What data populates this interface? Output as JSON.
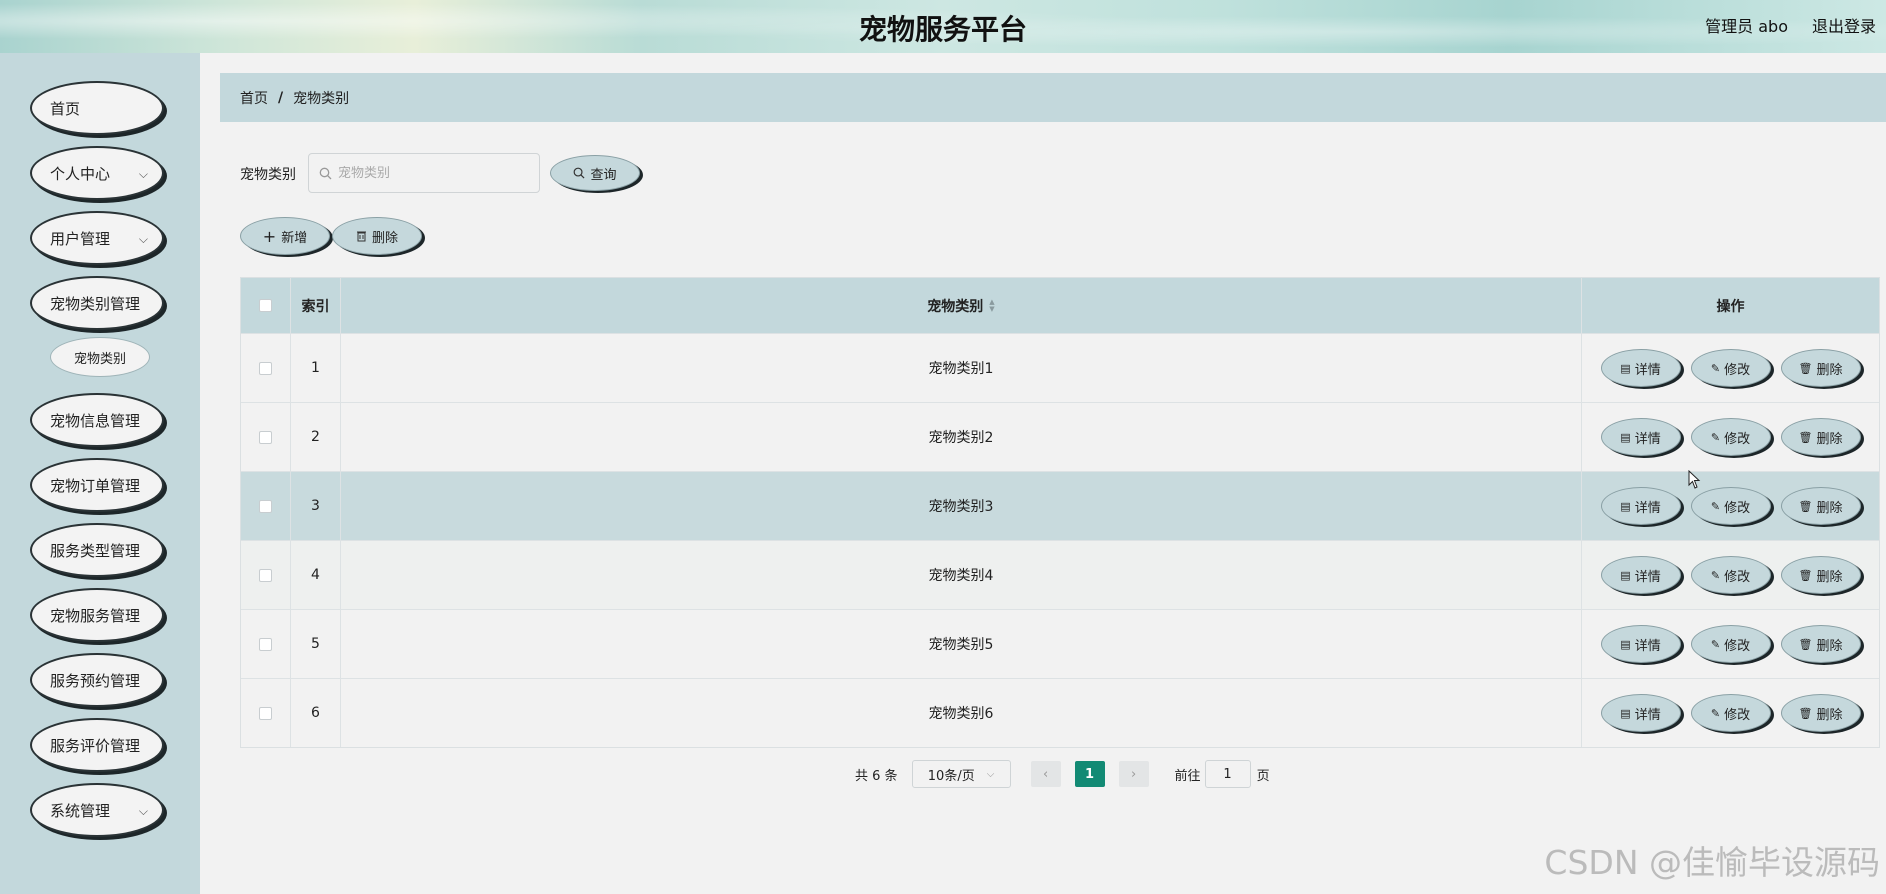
{
  "header": {
    "title": "宠物服务平台",
    "user_label": "管理员 abo",
    "logout_label": "退出登录"
  },
  "sidebar": {
    "items": [
      {
        "label": "首页",
        "has_submenu": false
      },
      {
        "label": "个人中心",
        "has_submenu": true
      },
      {
        "label": "用户管理",
        "has_submenu": true
      },
      {
        "label": "宠物类别管理",
        "has_submenu": false
      },
      {
        "label": "宠物信息管理",
        "has_submenu": false
      },
      {
        "label": "宠物订单管理",
        "has_submenu": false
      },
      {
        "label": "服务类型管理",
        "has_submenu": false
      },
      {
        "label": "宠物服务管理",
        "has_submenu": false
      },
      {
        "label": "服务预约管理",
        "has_submenu": false
      },
      {
        "label": "服务评价管理",
        "has_submenu": false
      },
      {
        "label": "系统管理",
        "has_submenu": true
      }
    ],
    "subitem": {
      "label": "宠物类别"
    }
  },
  "breadcrumb": {
    "home": "首页",
    "separator": "/",
    "current": "宠物类别"
  },
  "search": {
    "label": "宠物类别",
    "placeholder": "宠物类别",
    "value": "",
    "button_label": "查询"
  },
  "toolbar": {
    "add_label": "新增",
    "delete_label": "删除"
  },
  "table": {
    "columns": {
      "index": "索引",
      "name": "宠物类别",
      "ops": "操作"
    },
    "op_labels": {
      "detail": "详情",
      "edit": "修改",
      "delete": "删除"
    },
    "rows": [
      {
        "index": "1",
        "name": "宠物类别1"
      },
      {
        "index": "2",
        "name": "宠物类别2"
      },
      {
        "index": "3",
        "name": "宠物类别3"
      },
      {
        "index": "4",
        "name": "宠物类别4"
      },
      {
        "index": "5",
        "name": "宠物类别5"
      },
      {
        "index": "6",
        "name": "宠物类别6"
      }
    ]
  },
  "pagination": {
    "total_text": "共 6 条",
    "page_size": "10条/页",
    "current_page": "1",
    "goto_label": "前往",
    "goto_value": "1",
    "page_suffix": "页"
  },
  "watermark": "CSDN @佳愉毕设源码",
  "colors": {
    "accent": "#128a74",
    "panel": "#c3d8dc",
    "background": "#f2f2f2"
  }
}
